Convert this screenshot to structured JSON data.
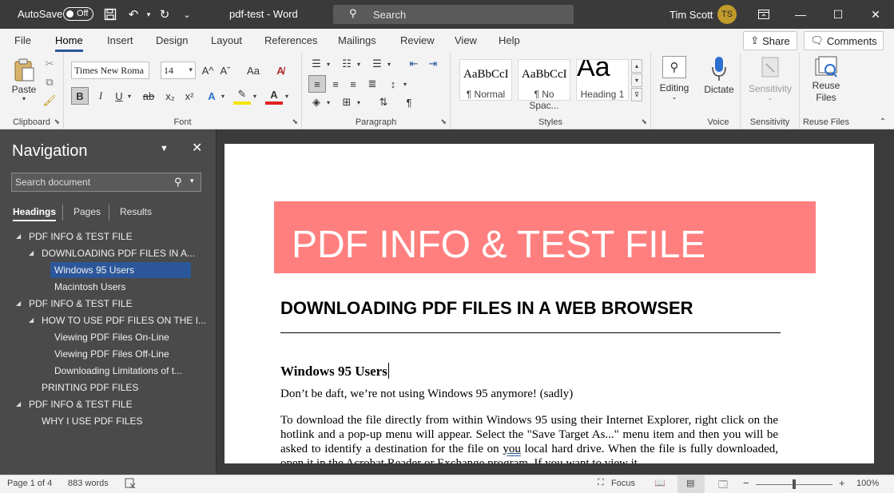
{
  "titlebar": {
    "autosave_label": "AutoSave",
    "autosave_state": "Off",
    "doc_title": "pdf-test  -  Word",
    "search_placeholder": "Search",
    "user_name": "Tim Scott",
    "user_initials": "TS"
  },
  "ribbon_tabs": [
    "File",
    "Home",
    "Insert",
    "Design",
    "Layout",
    "References",
    "Mailings",
    "Review",
    "View",
    "Help"
  ],
  "active_tab": "Home",
  "share_label": "Share",
  "comments_label": "Comments",
  "ribbon": {
    "clipboard": {
      "paste_label": "Paste",
      "group_label": "Clipboard"
    },
    "font": {
      "font_name": "Times New Roma",
      "font_size": "14",
      "group_label": "Font",
      "bold": "B",
      "italic": "I",
      "underline": "U",
      "strike": "ab",
      "subscript": "x₂",
      "superscript": "x²",
      "grow": "A^",
      "shrink": "Aˇ",
      "case": "Aa"
    },
    "paragraph": {
      "group_label": "Paragraph"
    },
    "styles": {
      "group_label": "Styles",
      "tiles": [
        {
          "sample": "AaBbCcI",
          "name": "¶ Normal"
        },
        {
          "sample": "AaBbCcI",
          "name": "¶ No Spac..."
        },
        {
          "sample": "Aa",
          "name": "Heading 1"
        }
      ]
    },
    "editing_label": "Editing",
    "dictate_label": "Dictate",
    "voice_group": "Voice",
    "sensitivity_label": "Sensitivity",
    "sensitivity_group": "Sensitivity",
    "reuse_label_1": "Reuse",
    "reuse_label_2": "Files",
    "reuse_group": "Reuse Files"
  },
  "navigation": {
    "title": "Navigation",
    "search_placeholder": "Search document",
    "tabs": [
      "Headings",
      "Pages",
      "Results"
    ],
    "tree": [
      {
        "text": "PDF INFO & TEST FILE"
      },
      {
        "text": "DOWNLOADING PDF FILES IN A..."
      },
      {
        "text": "Windows 95 Users"
      },
      {
        "text": "Macintosh Users"
      },
      {
        "text": "PDF INFO & TEST FILE"
      },
      {
        "text": "HOW TO USE PDF FILES ON THE I..."
      },
      {
        "text": "Viewing PDF Files On-Line"
      },
      {
        "text": "Viewing PDF Files Off-Line"
      },
      {
        "text": "Downloading Limitations of t..."
      },
      {
        "text": "PRINTING PDF FILES"
      },
      {
        "text": "PDF INFO & TEST FILE"
      },
      {
        "text": "WHY I USE PDF FILES"
      }
    ]
  },
  "document": {
    "banner_title": "PDF INFO & TEST FILE",
    "heading1": "DOWNLOADING PDF FILES IN A WEB BROWSER",
    "heading2": "Windows 95 Users",
    "para1": "Don’t be daft, we’re not using Windows 95 anymore! (sadly)",
    "para2_a": "To download the file directly from within Windows 95 using their Internet Explorer, right click on the hotlink and a pop-up menu will appear. Select the \"Save Target As...\" menu item and then you will be asked to identify a destination for the file on ",
    "para2_sq": "you",
    "para2_b": " local hard drive. When the file is fully downloaded, open it in the Acrobat Reader or Exchange program. If you want to view it"
  },
  "status": {
    "page": "Page 1 of 4",
    "words": "883 words",
    "focus": "Focus",
    "zoom": "100%",
    "zoom_fraction": 0.5
  },
  "colors": {
    "accent": "#2b579a",
    "banner": "#ff7f7f",
    "avatar": "#c19a2a",
    "titlebar": "#3a3a3a"
  }
}
